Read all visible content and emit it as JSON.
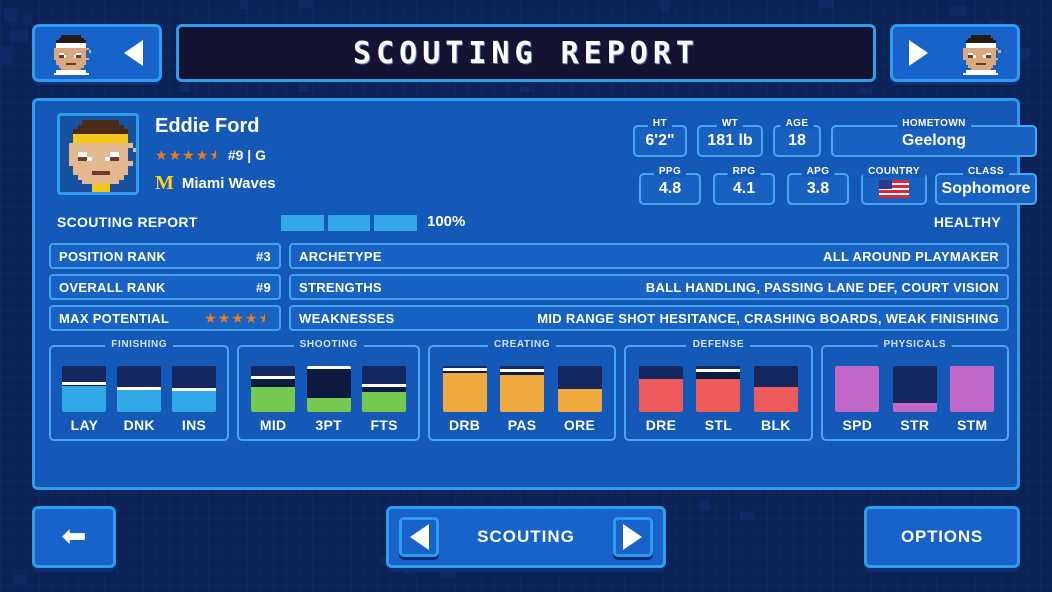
{
  "header": {
    "title": "SCOUTING REPORT",
    "prev_icon": "player-portrait-icon",
    "prev_arrow_icon": "triangle-left-icon",
    "next_arrow_icon": "triangle-right-icon",
    "next_icon": "player-portrait-icon"
  },
  "player": {
    "avatar_icon": "player-avatar-icon",
    "name": "Eddie Ford",
    "stars": 4.5,
    "jersey_position": "#9 | G",
    "team_logo": "M",
    "team_name": "Miami Waves"
  },
  "vitals": [
    {
      "label": "HT",
      "value": "6'2\""
    },
    {
      "label": "WT",
      "value": "181 lb"
    },
    {
      "label": "AGE",
      "value": "18"
    },
    {
      "label": "HOMETOWN",
      "value": "Geelong"
    }
  ],
  "stats": [
    {
      "label": "PPG",
      "value": "4.8"
    },
    {
      "label": "RPG",
      "value": "4.1"
    },
    {
      "label": "APG",
      "value": "3.8"
    },
    {
      "label": "COUNTRY",
      "value": "usa-flag-icon"
    },
    {
      "label": "CLASS",
      "value": "Sophomore"
    }
  ],
  "scouting": {
    "section_label": "SCOUTING REPORT",
    "progress_segments": 3,
    "progress_filled": 3,
    "progress_pct": "100%",
    "health_status": "HEALTHY"
  },
  "ranks": [
    {
      "key": "POSITION RANK",
      "value": "#3"
    },
    {
      "key": "OVERALL RANK",
      "value": "#9"
    },
    {
      "key": "MAX POTENTIAL",
      "value": "",
      "stars": 4.5
    }
  ],
  "traits": [
    {
      "key": "ARCHETYPE",
      "value": "ALL AROUND PLAYMAKER"
    },
    {
      "key": "STRENGTHS",
      "value": "BALL HANDLING, PASSING LANE DEF, COURT VISION"
    },
    {
      "key": "WEAKNESSES",
      "value": "MID RANGE SHOT HESITANCE, CRASHING BOARDS, WEAK FINISHING"
    }
  ],
  "attribute_groups": [
    {
      "label": "FINISHING",
      "color": "#31a8e8",
      "attrs": [
        {
          "label": "LAY",
          "fill": 56,
          "marker": 62
        },
        {
          "label": "DNK",
          "fill": 50,
          "marker": 51
        },
        {
          "label": "INS",
          "fill": 47,
          "marker": 48
        }
      ]
    },
    {
      "label": "SHOOTING",
      "color": "#76c94f",
      "attrs": [
        {
          "label": "MID",
          "fill": 54,
          "marker": 74
        },
        {
          "label": "3PT",
          "fill": 30,
          "marker": 97
        },
        {
          "label": "FTS",
          "fill": 43,
          "marker": 58
        }
      ]
    },
    {
      "label": "CREATING",
      "color": "#efa93f",
      "attrs": [
        {
          "label": "DRB",
          "fill": 84,
          "marker": 92
        },
        {
          "label": "PAS",
          "fill": 80,
          "marker": 90
        },
        {
          "label": "ORE",
          "fill": 50,
          "marker": 0
        }
      ]
    },
    {
      "label": "DEFENSE",
      "color": "#ef5a5a",
      "attrs": [
        {
          "label": "DRE",
          "fill": 72,
          "marker": 0
        },
        {
          "label": "STL",
          "fill": 72,
          "marker": 90
        },
        {
          "label": "BLK",
          "fill": 54,
          "marker": 0
        }
      ]
    },
    {
      "label": "PHYSICALS",
      "color": "#c168c9",
      "attrs": [
        {
          "label": "SPD",
          "fill": 100,
          "marker": 0
        },
        {
          "label": "STR",
          "fill": 19,
          "marker": 0
        },
        {
          "label": "STM",
          "fill": 100,
          "marker": 0
        }
      ]
    }
  ],
  "footer": {
    "back_icon": "arrow-left-icon",
    "selector_prev_icon": "triangle-left-icon",
    "selector_label": "SCOUTING",
    "selector_next_icon": "triangle-right-icon",
    "options_label": "OPTIONS"
  }
}
